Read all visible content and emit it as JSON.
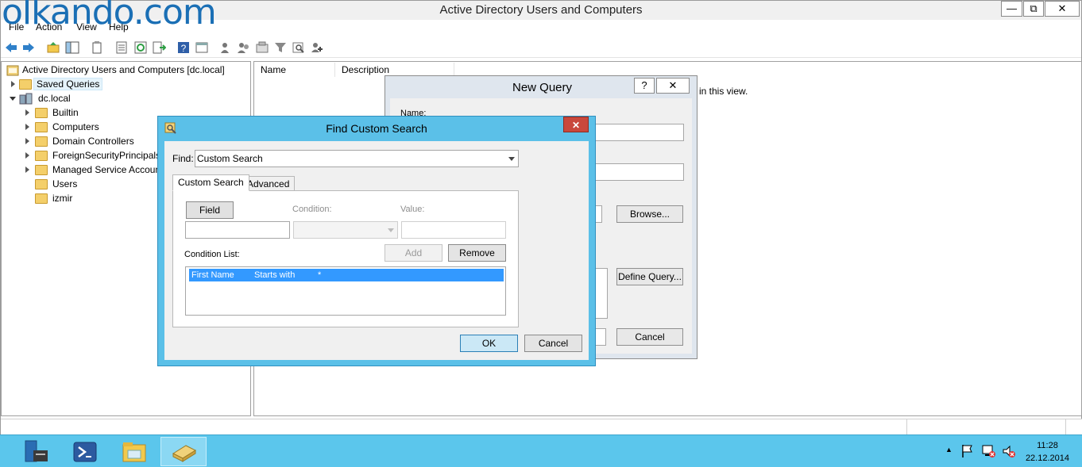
{
  "watermark": "olkando.com",
  "window": {
    "title": "Active Directory Users and Computers",
    "min_glyph": "—",
    "restore_glyph": "⧉",
    "close_glyph": "✕"
  },
  "menu": [
    "File",
    "Action",
    "View",
    "Help"
  ],
  "tree": {
    "root": "Active Directory Users and Computers [dc.local]",
    "items": [
      {
        "label": "Saved Queries"
      },
      {
        "label": "dc.local"
      },
      {
        "label": "Builtin"
      },
      {
        "label": "Computers"
      },
      {
        "label": "Domain Controllers"
      },
      {
        "label": "ForeignSecurityPrincipals"
      },
      {
        "label": "Managed Service Accoun"
      },
      {
        "label": "Users"
      },
      {
        "label": "izmir"
      }
    ]
  },
  "list": {
    "columns": [
      "Name",
      "Description"
    ],
    "empty_message": "in this view."
  },
  "new_query": {
    "title": "New Query",
    "help_glyph": "?",
    "close_glyph": "✕",
    "name_label": "Name:",
    "browse_label": "Browse...",
    "define_query_label": "Define Query...",
    "cancel_label": "Cancel"
  },
  "find_dialog": {
    "title": "Find Custom Search",
    "close_glyph": "✕",
    "find_label": "Find:",
    "find_value": "Custom Search",
    "tabs": [
      "Custom Search",
      "Advanced"
    ],
    "field_button": "Field",
    "condition_label": "Condition:",
    "value_label": "Value:",
    "condition_list_label": "Condition List:",
    "add_label": "Add",
    "remove_label": "Remove",
    "conditions": [
      {
        "field": "First Name",
        "condition": "Starts with",
        "value": "*"
      }
    ],
    "ok_label": "OK",
    "cancel_label": "Cancel"
  },
  "taskbar": {
    "time": "11:28",
    "date": "22.12.2014",
    "tray_arrow": "▲"
  }
}
